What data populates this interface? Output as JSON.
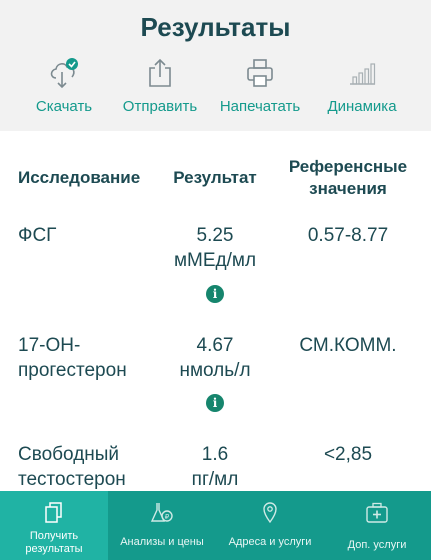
{
  "header": {
    "title": "Результаты"
  },
  "actions": [
    {
      "label": "Скачать",
      "icon": "cloud-download-icon"
    },
    {
      "label": "Отправить",
      "icon": "share-upload-icon"
    },
    {
      "label": "Напечатать",
      "icon": "printer-icon"
    },
    {
      "label": "Динамика",
      "icon": "bar-chart-icon"
    }
  ],
  "table": {
    "headers": {
      "test": "Исследование",
      "result": "Результат",
      "reference_line1": "Референсные",
      "reference_line2": "значения"
    },
    "rows": [
      {
        "name_line1": "ФСГ",
        "name_line2": "",
        "value": "5.25",
        "unit": "мМЕд/мл",
        "reference": "0.57-8.77",
        "has_info": true
      },
      {
        "name_line1": "17-ОН-",
        "name_line2": "прогестерон",
        "value": "4.67",
        "unit": "нмоль/л",
        "reference": "СМ.КОММ.",
        "has_info": true
      },
      {
        "name_line1": "Свободный",
        "name_line2": "тестостерон",
        "value": "1.6",
        "unit": "пг/мл",
        "reference": "<2,85",
        "has_info": false
      }
    ],
    "info_glyph": "i"
  },
  "nav": {
    "tabs": [
      {
        "line1": "Получить",
        "line2": "результаты",
        "icon": "document-icon",
        "active": true
      },
      {
        "line1": "Анализы и цены",
        "line2": "",
        "icon": "flask-icon",
        "active": false
      },
      {
        "line1": "Адреса и услуги",
        "line2": "",
        "icon": "map-pin-icon",
        "active": false
      },
      {
        "line1": "Доп. услуги",
        "line2": "",
        "icon": "medical-kit-icon",
        "active": false
      }
    ]
  },
  "colors": {
    "accent": "#149a8c",
    "nav_active": "#20b3a4",
    "text_dark": "#1d4a52",
    "info": "#16856d"
  }
}
